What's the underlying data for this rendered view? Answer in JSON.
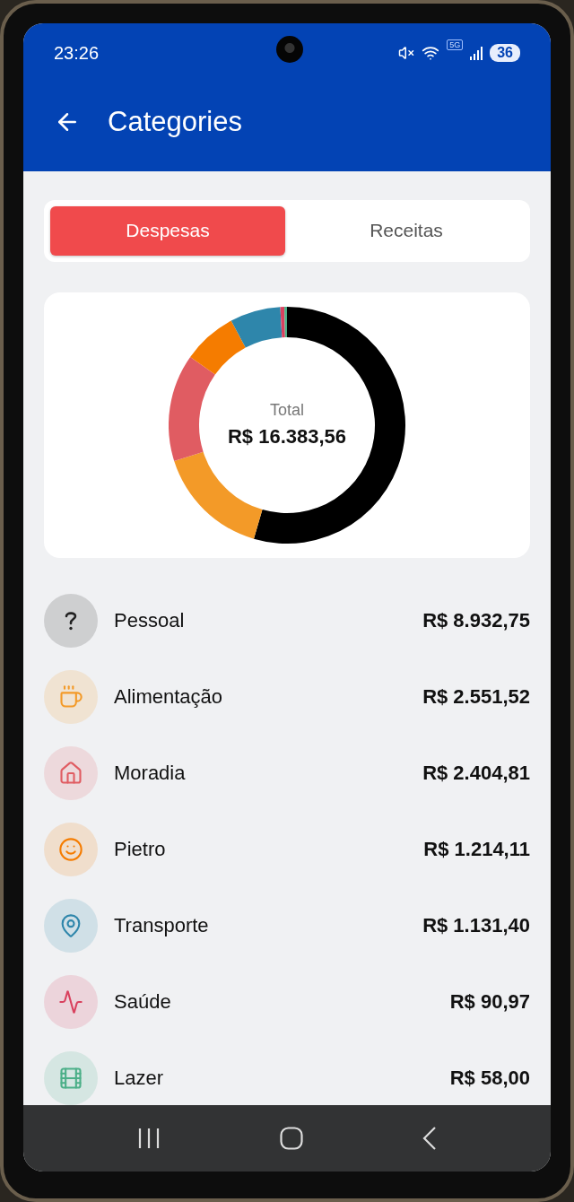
{
  "status_bar": {
    "time": "23:26",
    "network": "5G",
    "battery": "36"
  },
  "header": {
    "title": "Categories"
  },
  "tabs": [
    {
      "label": "Despesas",
      "selected": true
    },
    {
      "label": "Receitas",
      "selected": false
    }
  ],
  "summary": {
    "label": "Total",
    "amount": "R$ 16.383,56"
  },
  "categories": [
    {
      "name": "Pessoal",
      "amount": "R$ 8.932,75",
      "kind": "unknown",
      "color": "#000000"
    },
    {
      "name": "Alimentação",
      "amount": "R$ 2.551,52",
      "kind": "coffee",
      "color": "#f39a28"
    },
    {
      "name": "Moradia",
      "amount": "R$ 2.404,81",
      "kind": "home",
      "color": "#e05c62"
    },
    {
      "name": "Pietro",
      "amount": "R$ 1.214,11",
      "kind": "smile",
      "color": "#f57c00"
    },
    {
      "name": "Transporte",
      "amount": "R$ 1.131,40",
      "kind": "pin",
      "color": "#2e86ab"
    },
    {
      "name": "Saúde",
      "amount": "R$ 90,97",
      "kind": "pulse",
      "color": "#d9415e"
    },
    {
      "name": "Lazer",
      "amount": "R$ 58,00",
      "kind": "film",
      "color": "#4caf88"
    }
  ]
}
